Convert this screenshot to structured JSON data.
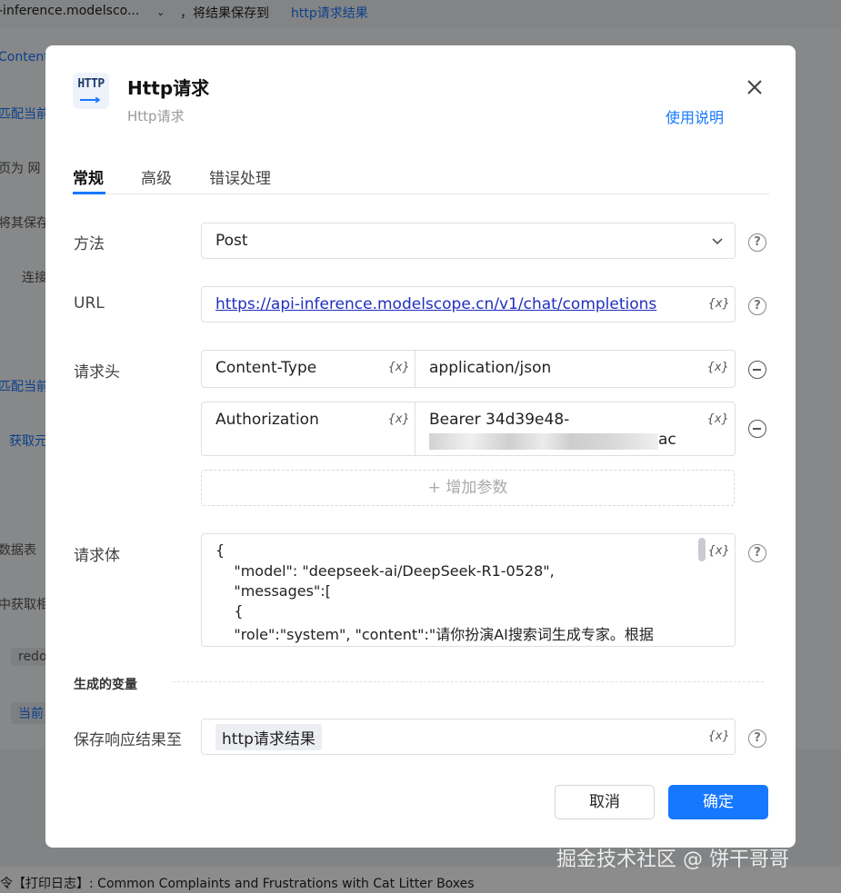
{
  "background": {
    "top_left_text": "-inference.modelsco...",
    "top_mid_text": "，将结果保存到",
    "top_link": "http请求结果",
    "rows": [
      "Content",
      "匹配当前",
      "页为   网",
      "将其保存",
      "连接",
      "匹配当前",
      "获取元",
      "数据表",
      "中获取相",
      "redo",
      "当前"
    ],
    "footer_log": "令【打印日志】: Common Complaints and Frustrations with Cat Litter Boxes"
  },
  "watermark": "掘金技术社区 @ 饼干哥哥",
  "dialog": {
    "logo_text": "HTTP",
    "title": "Http请求",
    "subtitle": "Http请求",
    "help_link": "使用说明",
    "close_icon": "close-icon",
    "tabs": [
      {
        "label": "常规",
        "active": true
      },
      {
        "label": "高级",
        "active": false
      },
      {
        "label": "错误处理",
        "active": false
      }
    ],
    "method": {
      "label": "方法",
      "value": "Post"
    },
    "url": {
      "label": "URL",
      "value": "https://api-inference.modelscope.cn/v1/chat/completions"
    },
    "headers": {
      "label": "请求头",
      "rows": [
        {
          "key": "Content-Type",
          "value": "application/json"
        },
        {
          "key": "Authorization",
          "value_line1": "Bearer 34d39e48-",
          "value_line2_tail": "ac"
        }
      ],
      "add_label": "+ 增加参数"
    },
    "body": {
      "label": "请求体",
      "lines": [
        "{",
        "    \"model\": \"deepseek-ai/DeepSeek-R1-0528\",",
        "    \"messages\":[",
        "    {",
        "    \"role\":\"system\", \"content\":\"请你扮演AI搜索词生成专家。根据"
      ]
    },
    "generated_vars_title": "生成的变量",
    "save_to": {
      "label": "保存响应结果至",
      "value": "http请求结果"
    },
    "var_icon_text": "{x}",
    "help_icon_text": "?",
    "buttons": {
      "cancel": "取消",
      "ok": "确定"
    }
  },
  "colors": {
    "accent": "#1677ff",
    "overlay": "rgba(0,0,0,0.45)"
  }
}
